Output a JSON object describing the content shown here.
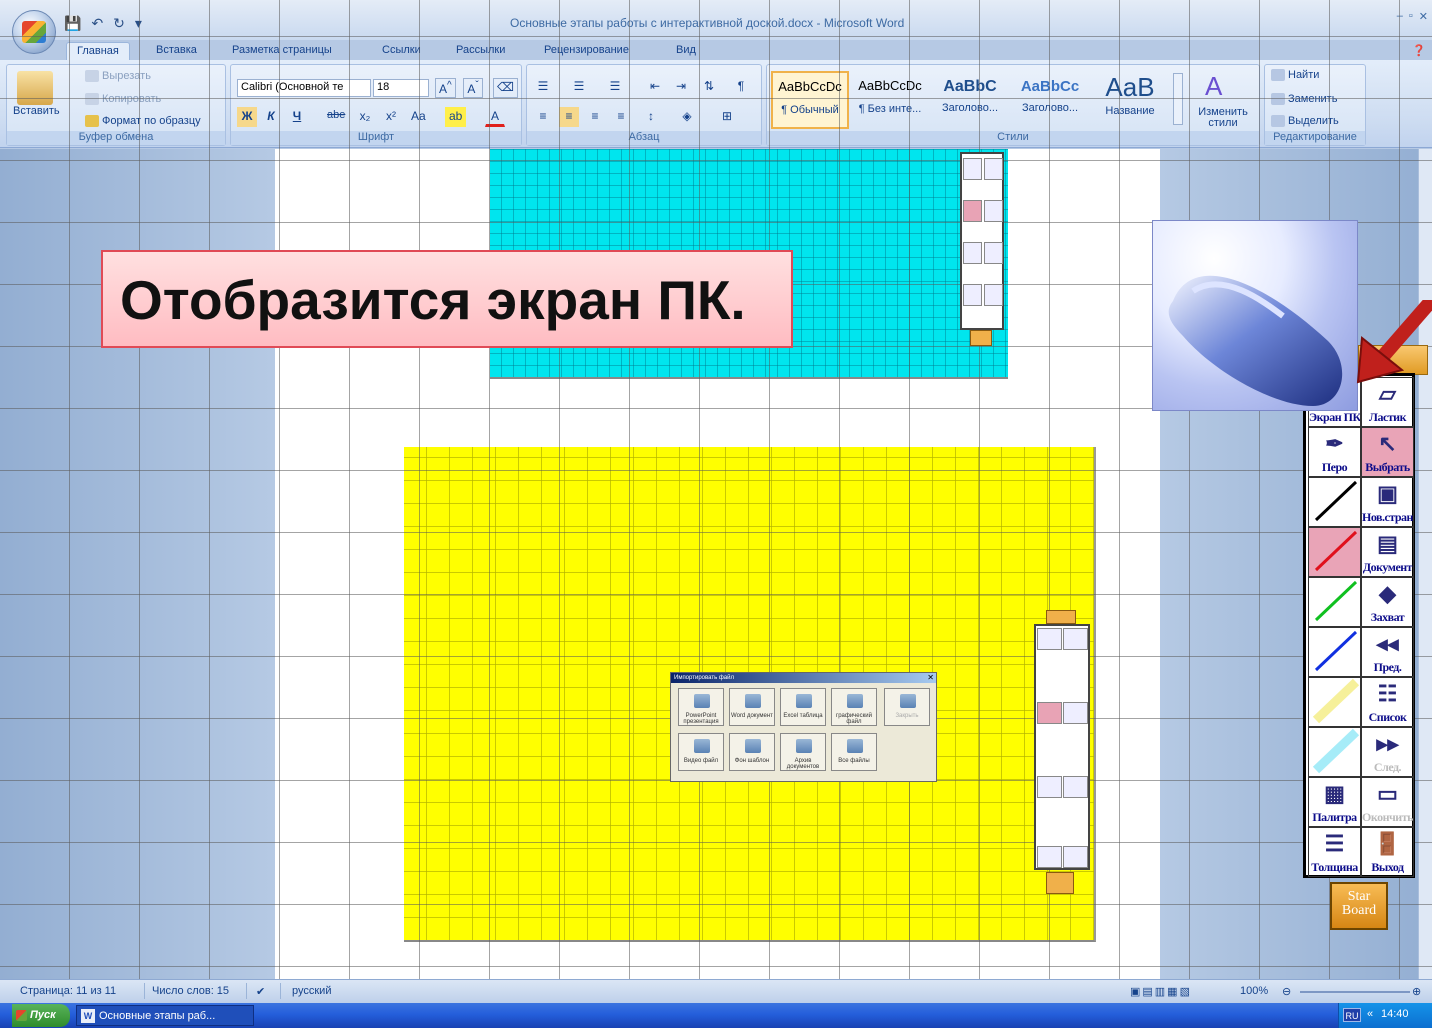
{
  "window": {
    "title": "Основные этапы работы с интерактивной доской.docx - Microsoft Word",
    "controls": [
      "–",
      "▫",
      "✕"
    ]
  },
  "tabs": [
    {
      "label": "Главная",
      "active": true
    },
    {
      "label": "Вставка"
    },
    {
      "label": "Разметка страницы"
    },
    {
      "label": "Ссылки"
    },
    {
      "label": "Рассылки"
    },
    {
      "label": "Рецензирование"
    },
    {
      "label": "Вид"
    }
  ],
  "ribbon": {
    "clipboard": {
      "paste": "Вставить",
      "cut": "Вырезать",
      "copy": "Копировать",
      "format_painter": "Формат по образцу",
      "group_label": "Буфер обмена"
    },
    "font": {
      "font_name": "Calibri (Основной те",
      "font_size": "18",
      "buttons": [
        "Ж",
        "К",
        "Ч",
        "abe",
        "x₂",
        "x²",
        "Aa"
      ],
      "group_label": "Шрифт"
    },
    "paragraph": {
      "group_label": "Абзац"
    },
    "styles": {
      "items": [
        {
          "preview": "AaBbCcDc",
          "name": "¶ Обычный",
          "selected": true
        },
        {
          "preview": "AaBbCcDc",
          "name": "¶ Без инте..."
        },
        {
          "preview": "AaBbC",
          "name": "Заголово..."
        },
        {
          "preview": "AaBbCc",
          "name": "Заголово..."
        },
        {
          "preview": "AaB",
          "name": "Название"
        }
      ],
      "change_styles": "Изменить стили",
      "group_label": "Стили"
    },
    "editing": {
      "find": "Найти",
      "replace": "Заменить",
      "select": "Выделить",
      "group_label": "Редактирование"
    }
  },
  "callout": {
    "text": "Отобразится экран ПК."
  },
  "import_dialog": {
    "title": "Импортировать файл",
    "buttons": [
      "PowerPoint презентация",
      "Word документ",
      "Excel таблица",
      "графический файл",
      "Закрыть",
      "Видео файл",
      "Фон шаблон",
      "Архив документов",
      "Все файлы"
    ]
  },
  "starboard": {
    "items": [
      {
        "label": "Экран ПК",
        "glyph": "🖱"
      },
      {
        "label": "Ластик",
        "glyph": "▱"
      },
      {
        "label": "Перо",
        "glyph": "✒"
      },
      {
        "label": "Выбрать",
        "glyph": "↖"
      },
      {
        "label": "",
        "glyph": "╱"
      },
      {
        "label": "Нов.стран.",
        "glyph": "▣"
      },
      {
        "label": "",
        "glyph": "╱"
      },
      {
        "label": "Документ",
        "glyph": "▤"
      },
      {
        "label": "",
        "glyph": "╱"
      },
      {
        "label": "Захват",
        "glyph": "◆"
      },
      {
        "label": "",
        "glyph": "╱"
      },
      {
        "label": "Пред.",
        "glyph": "◂◂"
      },
      {
        "label": "",
        "glyph": "╱"
      },
      {
        "label": "Список",
        "glyph": "☷"
      },
      {
        "label": "",
        "glyph": "╱"
      },
      {
        "label": "След.",
        "glyph": "▸▸"
      },
      {
        "label": "Палитра",
        "glyph": "▦"
      },
      {
        "label": "Окончить",
        "glyph": "▭"
      },
      {
        "label": "Толщина",
        "glyph": "☰"
      },
      {
        "label": "Выход",
        "glyph": "🚪"
      }
    ],
    "logo": "Star Board"
  },
  "status": {
    "page": "Страница: 11 из 11",
    "words": "Число слов: 15",
    "language": "русский",
    "zoom": "100%"
  },
  "taskbar": {
    "start": "Пуск",
    "task": "Основные этапы раб...",
    "lang": "RU",
    "time": "14:40"
  }
}
